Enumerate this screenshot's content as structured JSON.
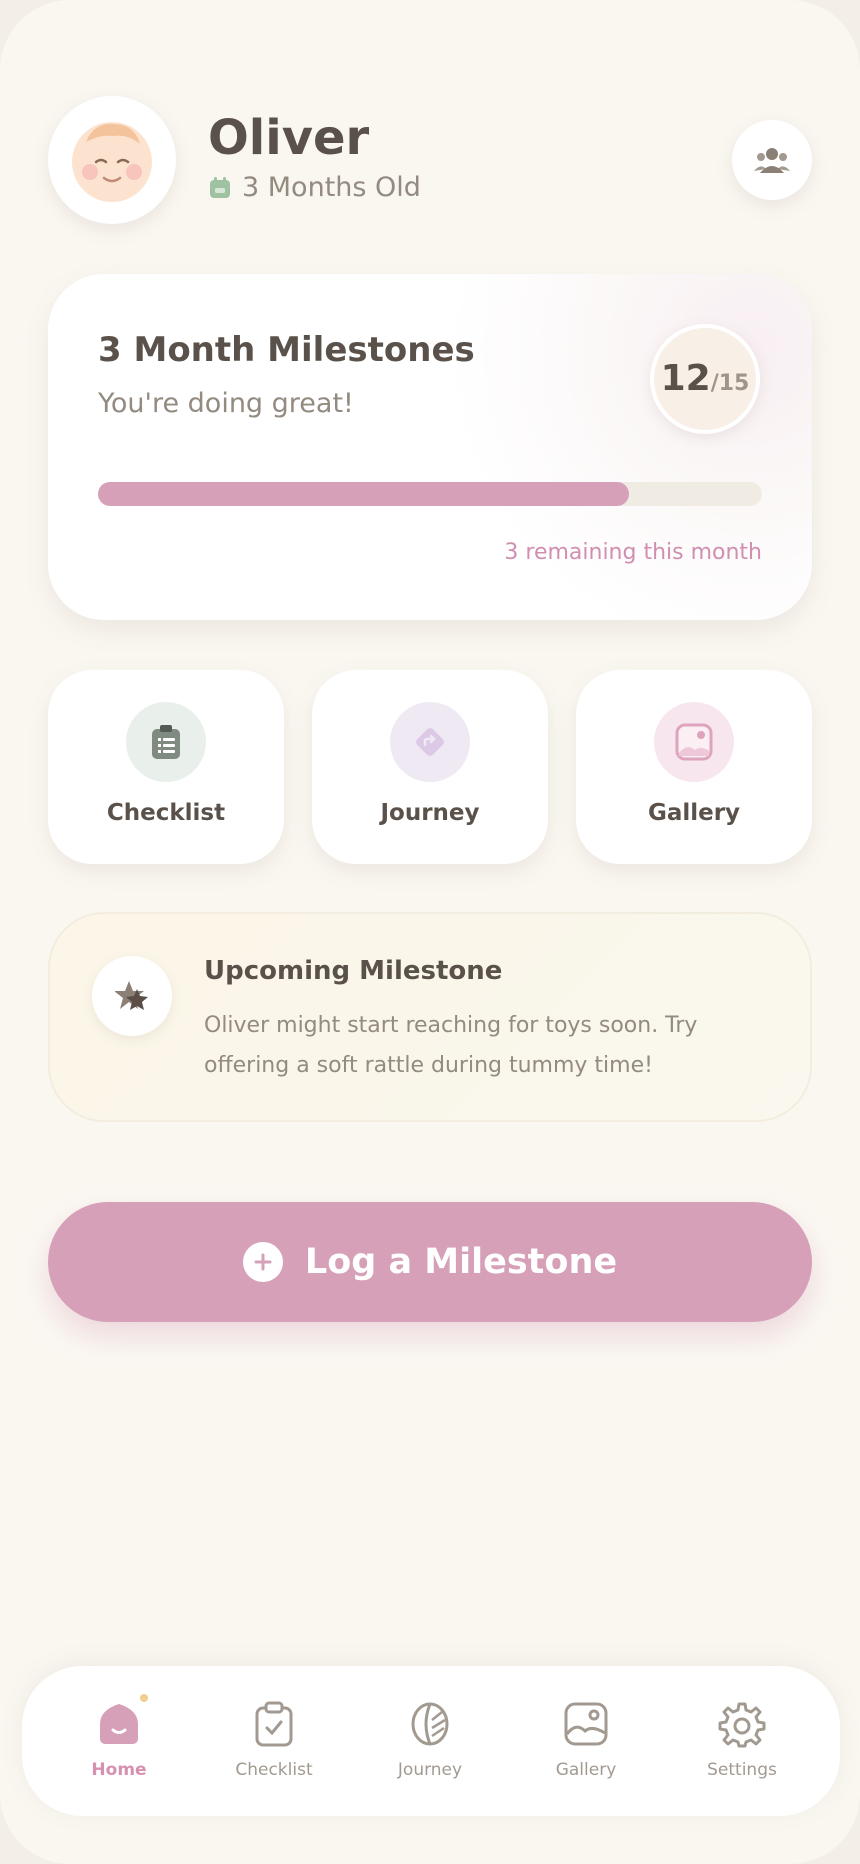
{
  "profile": {
    "name": "Oliver",
    "age": "3 Months Old"
  },
  "milestones": {
    "title": "3 Month Milestones",
    "subtitle": "You're doing great!",
    "completed": "12",
    "total": "/15",
    "progress_fraction": 0.8,
    "remaining": "3 remaining this month"
  },
  "tiles": [
    {
      "label": "Checklist",
      "icon": "clipboard-icon"
    },
    {
      "label": "Journey",
      "icon": "diamond-arrow-icon"
    },
    {
      "label": "Gallery",
      "icon": "image-icon"
    }
  ],
  "upcoming": {
    "title": "Upcoming Milestone",
    "text": "Oliver might start reaching for toys soon. Try offering a soft rattle during tummy time!"
  },
  "action": {
    "log_label": "Log a Milestone"
  },
  "nav": [
    {
      "label": "Home",
      "icon": "home-icon",
      "active": true
    },
    {
      "label": "Checklist",
      "icon": "clipboard-check-icon"
    },
    {
      "label": "Journey",
      "icon": "leaf-icon"
    },
    {
      "label": "Gallery",
      "icon": "image-icon"
    },
    {
      "label": "Settings",
      "icon": "gear-icon"
    }
  ],
  "colors": {
    "background": "#faf7f1",
    "accent_pink": "#d6a0b9",
    "text_dark": "#5a524a",
    "text_muted": "#938a80"
  }
}
